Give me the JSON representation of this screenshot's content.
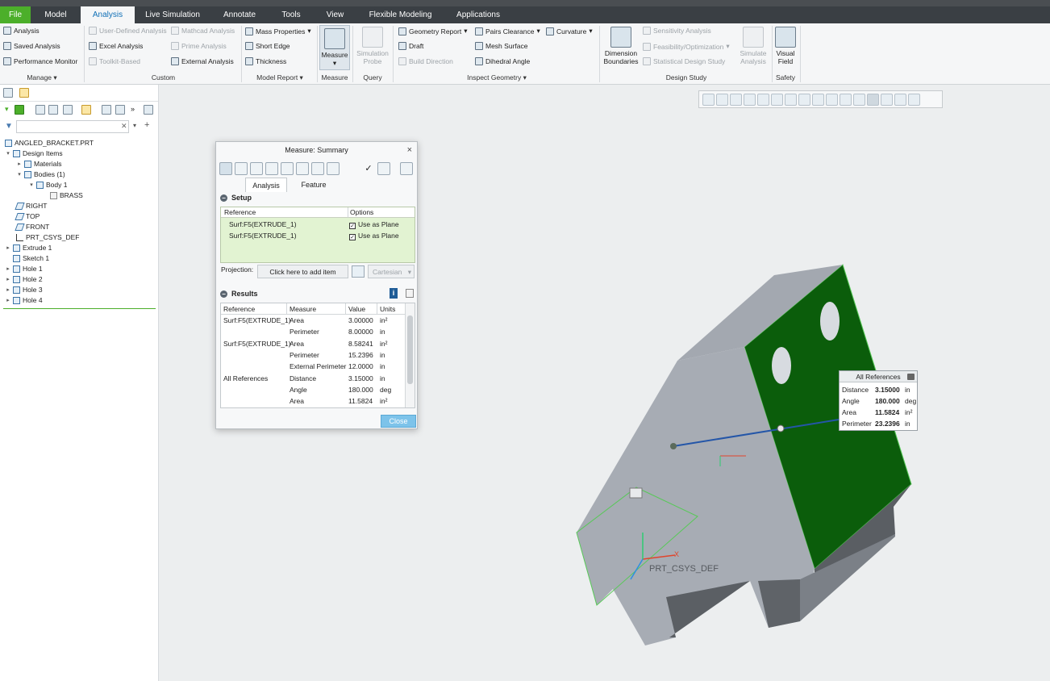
{
  "tabs": [
    "File",
    "Model",
    "Analysis",
    "Live Simulation",
    "Annotate",
    "Tools",
    "View",
    "Flexible Modeling",
    "Applications"
  ],
  "ribbon": {
    "manage": {
      "items": [
        "Analysis",
        "Saved Analysis",
        "Performance Monitor"
      ],
      "group": "Manage"
    },
    "custom": {
      "col1": [
        "User-Defined Analysis",
        "Excel Analysis",
        "Toolkit-Based"
      ],
      "col2": [
        "Mathcad Analysis",
        "Prime Analysis",
        "External Analysis"
      ],
      "group": "Custom"
    },
    "model_report": {
      "items": [
        "Mass Properties",
        "Short Edge",
        "Thickness"
      ],
      "group": "Model Report"
    },
    "measure": {
      "label": "Measure",
      "group": "Measure"
    },
    "query": {
      "label1": "Simulation",
      "label2": "Probe",
      "group": "Query"
    },
    "inspect": {
      "col1": [
        "Geometry Report",
        "Draft",
        "Build Direction"
      ],
      "col2": [
        "Pairs Clearance",
        "Mesh Surface",
        "Dihedral Angle"
      ],
      "col3": [
        "Curvature"
      ],
      "group": "Inspect Geometry"
    },
    "design_study": {
      "dim1": "Dimension",
      "dim2": "Boundaries",
      "items": [
        "Sensitivity Analysis",
        "Feasibility/Optimization",
        "Statistical Design Study"
      ],
      "sim1": "Simulate",
      "sim2": "Analysis",
      "group": "Design Study"
    },
    "safety": {
      "label1": "Visual",
      "label2": "Field",
      "group": "Safety"
    }
  },
  "tree": {
    "root": "ANGLED_BRACKET.PRT",
    "items": [
      "Design Items",
      "Materials",
      "Bodies (1)",
      "Body 1",
      "BRASS",
      "RIGHT",
      "TOP",
      "FRONT",
      "PRT_CSYS_DEF",
      "Extrude 1",
      "Sketch 1",
      "Hole 1",
      "Hole 2",
      "Hole 3",
      "Hole 4"
    ]
  },
  "dialog": {
    "title": "Measure: Summary",
    "close_x": "×",
    "tabs": [
      "Analysis",
      "Feature"
    ],
    "setup_title": "Setup",
    "setup_headers": [
      "Reference",
      "Options"
    ],
    "setup_rows": [
      {
        "ref": "Surf:F5(EXTRUDE_1)",
        "opt": "Use as Plane"
      },
      {
        "ref": "Surf:F5(EXTRUDE_1)",
        "opt": "Use as Plane"
      }
    ],
    "projection_label": "Projection:",
    "projection_value": "Click here to add item",
    "projection_mode": "Cartesian",
    "results_title": "Results",
    "results_headers": [
      "Reference",
      "Measure",
      "Value",
      "Units"
    ],
    "results_rows": [
      {
        "ref": "Surf:F5(EXTRUDE_1)",
        "measure": "Area",
        "value": "3.00000",
        "units": "in²"
      },
      {
        "ref": "",
        "measure": "Perimeter",
        "value": "8.00000",
        "units": "in"
      },
      {
        "ref": "Surf:F5(EXTRUDE_1)",
        "measure": "Area",
        "value": "8.58241",
        "units": "in²"
      },
      {
        "ref": "",
        "measure": "Perimeter",
        "value": "15.2396",
        "units": "in"
      },
      {
        "ref": "",
        "measure": "External Perimeter",
        "value": "12.0000",
        "units": "in"
      },
      {
        "ref": "All References",
        "measure": "Distance",
        "value": "3.15000",
        "units": "in"
      },
      {
        "ref": "",
        "measure": "Angle",
        "value": "180.000",
        "units": "deg"
      },
      {
        "ref": "",
        "measure": "Area",
        "value": "11.5824",
        "units": "in²"
      }
    ],
    "close_label": "Close"
  },
  "callout": {
    "title": "All References",
    "rows": [
      {
        "k": "Distance",
        "v": "3.15000",
        "u": "in"
      },
      {
        "k": "Angle",
        "v": "180.000",
        "u": "deg"
      },
      {
        "k": "Area",
        "v": "11.5824",
        "u": "in²"
      },
      {
        "k": "Perimeter",
        "v": "23.2396",
        "u": "in"
      }
    ]
  },
  "model": {
    "csys_label": "PRT_CSYS_DEF",
    "axis_x": "X"
  },
  "colors": {
    "file_tab": "#4caf2a",
    "selected_face": "#0b5d0b",
    "body": "#a7acb4"
  }
}
